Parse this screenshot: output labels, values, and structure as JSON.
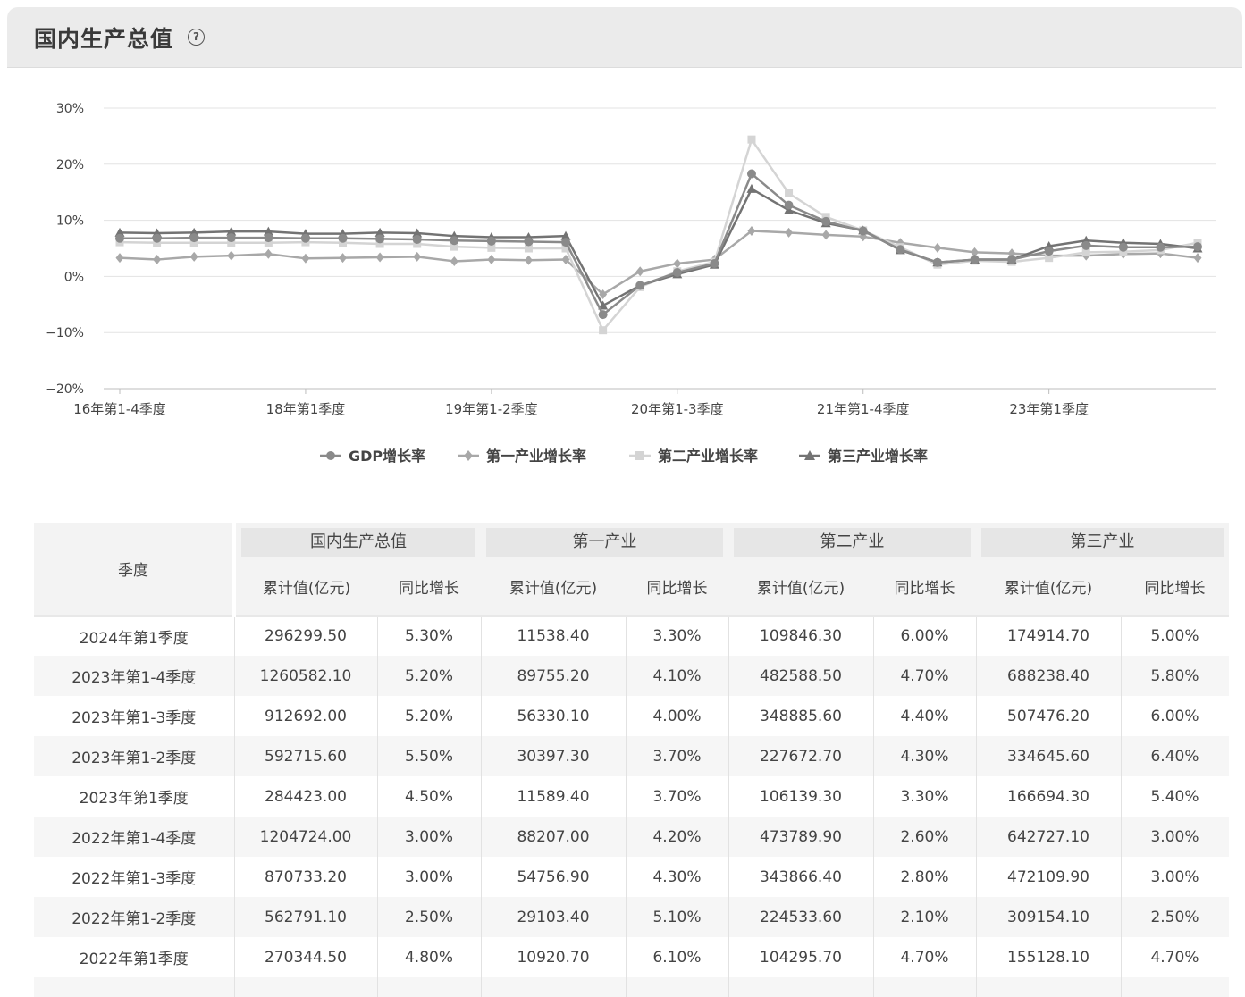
{
  "panel": {
    "title": "国内生产总值",
    "help_icon": "help-circle-icon"
  },
  "chart_data": {
    "type": "line",
    "ylim": [
      -20,
      30
    ],
    "yticks": [
      "30%",
      "20%",
      "10%",
      "0%",
      "−10%",
      "−20%"
    ],
    "ytick_values": [
      30,
      20,
      10,
      0,
      -10,
      -20
    ],
    "x_ticks": [
      {
        "index": 0,
        "label": "16年第1-4季度"
      },
      {
        "index": 5,
        "label": "18年第1季度"
      },
      {
        "index": 10,
        "label": "19年第1-2季度"
      },
      {
        "index": 15,
        "label": "20年第1-3季度"
      },
      {
        "index": 20,
        "label": "21年第1-4季度"
      },
      {
        "index": 25,
        "label": "23年第1季度"
      }
    ],
    "series": [
      {
        "name": "GDP增长率",
        "color": "#8a8a8a",
        "marker": "circle",
        "values": [
          6.8,
          6.8,
          6.9,
          6.9,
          6.9,
          6.8,
          6.8,
          6.7,
          6.6,
          6.4,
          6.3,
          6.2,
          6.1,
          -6.8,
          -1.6,
          0.7,
          2.3,
          18.3,
          12.7,
          9.8,
          8.1,
          4.8,
          2.5,
          3.0,
          3.0,
          4.5,
          5.5,
          5.2,
          5.2,
          5.3
        ]
      },
      {
        "name": "第一产业增长率",
        "color": "#a8a8a8",
        "marker": "diamond",
        "values": [
          3.3,
          3.0,
          3.5,
          3.7,
          4.0,
          3.2,
          3.3,
          3.4,
          3.5,
          2.7,
          3.0,
          2.9,
          3.0,
          -3.2,
          0.9,
          2.3,
          3.0,
          8.1,
          7.8,
          7.4,
          7.1,
          6.0,
          5.1,
          4.3,
          4.1,
          3.7,
          3.7,
          4.0,
          4.1,
          3.3
        ]
      },
      {
        "name": "第二产业增长率",
        "color": "#d4d4d4",
        "marker": "square",
        "values": [
          6.1,
          6.0,
          6.0,
          6.0,
          6.0,
          6.1,
          6.0,
          5.8,
          5.8,
          5.3,
          5.1,
          5.0,
          5.0,
          -9.6,
          -1.9,
          0.9,
          2.6,
          24.4,
          14.8,
          10.6,
          8.2,
          5.2,
          2.1,
          2.8,
          2.6,
          3.3,
          4.3,
          4.4,
          4.7,
          6.0
        ]
      },
      {
        "name": "第三产业增长率",
        "color": "#737373",
        "marker": "triangle",
        "values": [
          7.8,
          7.7,
          7.8,
          8.0,
          8.0,
          7.6,
          7.6,
          7.8,
          7.7,
          7.2,
          7.0,
          7.0,
          7.2,
          -5.2,
          -1.6,
          0.4,
          2.1,
          15.6,
          11.8,
          9.5,
          8.2,
          4.7,
          2.5,
          3.0,
          3.0,
          5.4,
          6.4,
          6.0,
          5.8,
          5.0
        ]
      }
    ]
  },
  "table": {
    "season_header": "季度",
    "groups": [
      "国内生产总值",
      "第一产业",
      "第二产业",
      "第三产业"
    ],
    "sub_headers": [
      "累计值(亿元)",
      "同比增长"
    ],
    "rows": [
      [
        "2024年第1季度",
        "296299.50",
        "5.30%",
        "11538.40",
        "3.30%",
        "109846.30",
        "6.00%",
        "174914.70",
        "5.00%"
      ],
      [
        "2023年第1-4季度",
        "1260582.10",
        "5.20%",
        "89755.20",
        "4.10%",
        "482588.50",
        "4.70%",
        "688238.40",
        "5.80%"
      ],
      [
        "2023年第1-3季度",
        "912692.00",
        "5.20%",
        "56330.10",
        "4.00%",
        "348885.60",
        "4.40%",
        "507476.20",
        "6.00%"
      ],
      [
        "2023年第1-2季度",
        "592715.60",
        "5.50%",
        "30397.30",
        "3.70%",
        "227672.70",
        "4.30%",
        "334645.60",
        "6.40%"
      ],
      [
        "2023年第1季度",
        "284423.00",
        "4.50%",
        "11589.40",
        "3.70%",
        "106139.30",
        "3.30%",
        "166694.30",
        "5.40%"
      ],
      [
        "2022年第1-4季度",
        "1204724.00",
        "3.00%",
        "88207.00",
        "4.20%",
        "473789.90",
        "2.60%",
        "642727.10",
        "3.00%"
      ],
      [
        "2022年第1-3季度",
        "870733.20",
        "3.00%",
        "54756.90",
        "4.30%",
        "343866.40",
        "2.80%",
        "472109.90",
        "3.00%"
      ],
      [
        "2022年第1-2季度",
        "562791.10",
        "2.50%",
        "29103.40",
        "5.10%",
        "224533.60",
        "2.10%",
        "309154.10",
        "2.50%"
      ],
      [
        "2022年第1季度",
        "270344.50",
        "4.80%",
        "10920.70",
        "6.10%",
        "104295.70",
        "4.70%",
        "155128.10",
        "4.70%"
      ],
      [
        "",
        "",
        "",
        "",
        "",
        "",
        "",
        "",
        ""
      ]
    ]
  }
}
